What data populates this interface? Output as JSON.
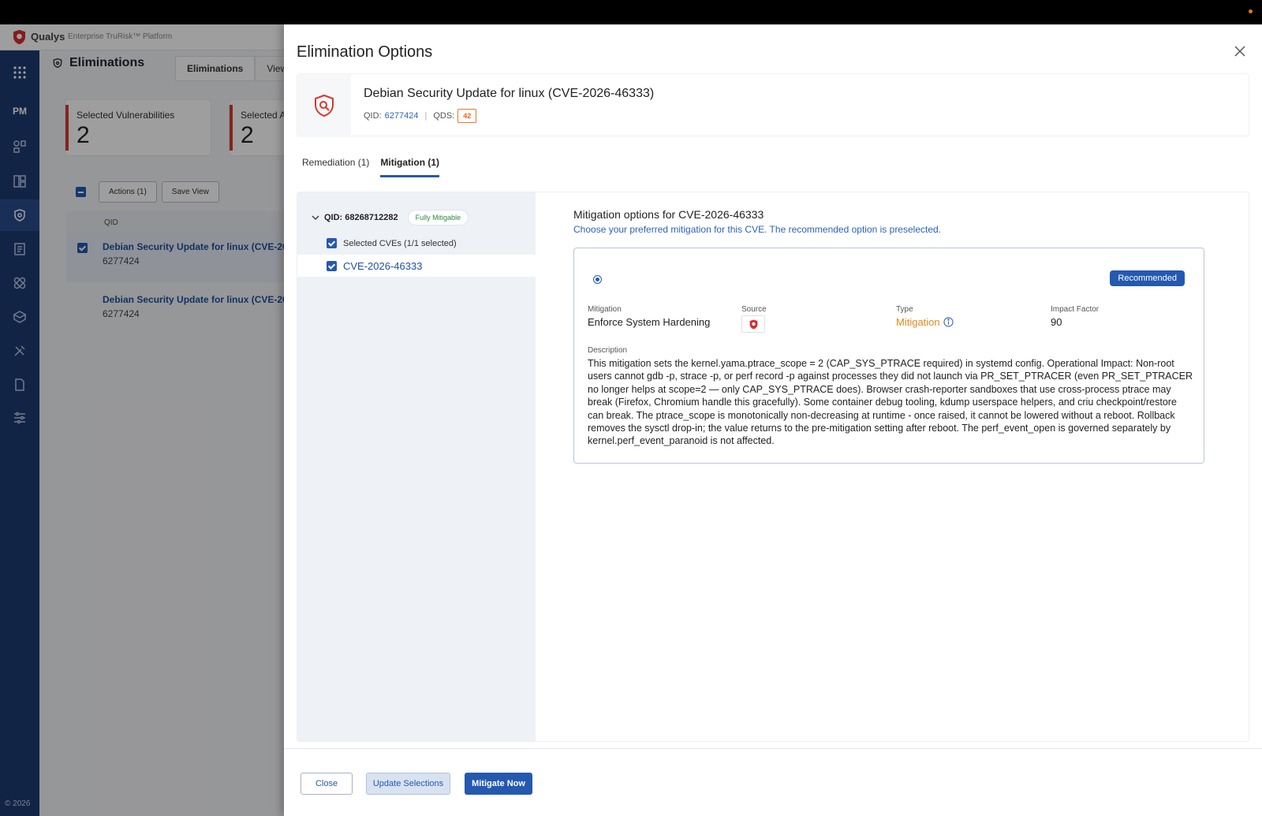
{
  "app": {
    "brand": "Qualys",
    "brand_sub": "Enterprise TruRisk™ Platform",
    "module": "PM",
    "page_title": "Eliminations",
    "tabs": [
      "Eliminations",
      "View"
    ],
    "copyright": "© 2026"
  },
  "stats": [
    {
      "label": "Selected Vulnerabilities",
      "value": "2"
    },
    {
      "label": "Selected A",
      "value": "2"
    }
  ],
  "toolbar": {
    "actions_label": "Actions (1)",
    "save_view_label": "Save View"
  },
  "table": {
    "header": "QID",
    "rows": [
      {
        "title": "Debian Security Update for linux (CVE-20",
        "qid": "6277424",
        "selected": true
      },
      {
        "title": "Debian Security Update for linux (CVE-20",
        "qid": "6277424",
        "selected": false
      }
    ]
  },
  "modal": {
    "title": "Elimination Options",
    "vuln_title": "Debian Security Update for linux (CVE-2026-46333)",
    "qid_label": "QID:",
    "qid_value": "6277424",
    "qds_label": "QDS:",
    "qds_value": "42",
    "tabs": [
      "Remediation (1)",
      "Mitigation (1)"
    ],
    "active_tab": "Mitigation (1)",
    "left": {
      "qid_group": "QID: 68268712282",
      "badge": "Fully Mitigable",
      "selected_cves": "Selected CVEs (1/1 selected)",
      "cve": "CVE-2026-46333"
    },
    "right": {
      "title": "Mitigation options for CVE-2026-46333",
      "subtitle": "Choose your preferred mitigation for this CVE. The recommended option is preselected.",
      "recommended": "Recommended",
      "mitigation_label": "Mitigation",
      "mitigation_value": "Enforce System Hardening",
      "source_label": "Source",
      "type_label": "Type",
      "type_value": "Mitigation",
      "impact_label": "Impact Factor",
      "impact_value": "90",
      "description_label": "Description",
      "description": "This mitigation sets the kernel.yama.ptrace_scope = 2 (CAP_SYS_PTRACE required) in systemd config. Operational Impact: Non-root users cannot gdb -p, strace -p, or perf record -p against processes they did not launch via PR_SET_PTRACER (even PR_SET_PTRACER no longer helps at scope=2 — only CAP_SYS_PTRACE does). Browser crash-reporter sandboxes that use cross-process ptrace may break (Firefox, Chromium handle this gracefully). Some container debug tooling, kdump userspace helpers, and criu checkpoint/restore can break. The ptrace_scope is monotonically non-decreasing at runtime - once raised, it cannot be lowered without a reboot. Rollback removes the sysctl drop-in; the value returns to the pre-mitigation setting after reboot. The perf_event_open is governed separately by kernel.perf_event_paranoid is not affected."
    },
    "footer": {
      "close": "Close",
      "update": "Update Selections",
      "mitigate": "Mitigate Now"
    }
  },
  "colors": {
    "primary": "#2459b0",
    "nav": "#1c3a72",
    "accent_red": "#d43a2a",
    "type_orange": "#e58a1a"
  }
}
